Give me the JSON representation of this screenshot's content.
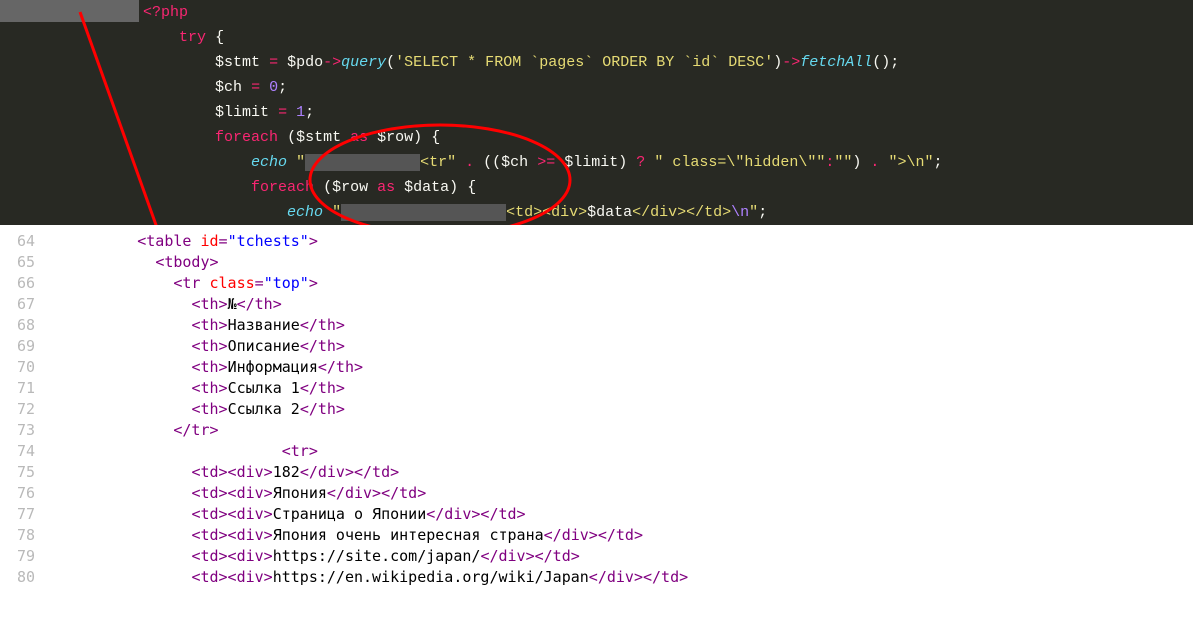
{
  "dark": {
    "php_open": "<?php",
    "try": "try",
    "brace_open": "{",
    "brace_close": "}",
    "stmt": "$stmt",
    "eq": "=",
    "pdo": "$pdo",
    "arrow": "->",
    "query": "query",
    "lparen": "(",
    "rparen": ")",
    "sql1": "'SELECT * FROM `pages` ORDER BY `id` DESC'",
    "fetchAll": "fetchAll",
    "semi": ";",
    "ch": "$ch",
    "zero": "0",
    "limit": "$limit",
    "one": "1",
    "foreach": "foreach",
    "as": "as",
    "row": "$row",
    "data": "$data",
    "echo": "echo",
    "quote": "\"",
    "tr_frag": "<tr\"",
    "dot": ".",
    "ternary1_open": "((",
    "gte": ">=",
    "ternary1_close": ")",
    "q": "?",
    "class_hidden": "\" class=\\\"hidden\\\"\"",
    "colon": ":",
    "empty": "\"\"",
    "close_paren": ")",
    "end_frag": "\">\\n\"",
    "td_frag": "<td><div>",
    "data_close": "</div></td>",
    "nl": "\\n"
  },
  "light": {
    "lines": [
      {
        "n": 64,
        "ind": 8,
        "parts": [
          [
            "tag",
            "<table "
          ],
          [
            "attr",
            "id"
          ],
          [
            "tag",
            "="
          ],
          [
            "attval",
            "\"tchests\""
          ],
          [
            "tag",
            ">"
          ]
        ]
      },
      {
        "n": 65,
        "ind": 10,
        "parts": [
          [
            "tag",
            "<tbody>"
          ]
        ]
      },
      {
        "n": 66,
        "ind": 12,
        "parts": [
          [
            "tag",
            "<tr "
          ],
          [
            "attr",
            "class"
          ],
          [
            "tag",
            "="
          ],
          [
            "attval",
            "\"top\""
          ],
          [
            "tag",
            ">"
          ]
        ]
      },
      {
        "n": 67,
        "ind": 14,
        "parts": [
          [
            "tag",
            "<th>"
          ],
          [
            "text",
            "№"
          ],
          [
            "tag",
            "</th>"
          ]
        ]
      },
      {
        "n": 68,
        "ind": 14,
        "parts": [
          [
            "tag",
            "<th>"
          ],
          [
            "text",
            "Название"
          ],
          [
            "tag",
            "</th>"
          ]
        ]
      },
      {
        "n": 69,
        "ind": 14,
        "parts": [
          [
            "tag",
            "<th>"
          ],
          [
            "text",
            "Описание"
          ],
          [
            "tag",
            "</th>"
          ]
        ]
      },
      {
        "n": 70,
        "ind": 14,
        "parts": [
          [
            "tag",
            "<th>"
          ],
          [
            "text",
            "Информация"
          ],
          [
            "tag",
            "</th>"
          ]
        ]
      },
      {
        "n": 71,
        "ind": 14,
        "parts": [
          [
            "tag",
            "<th>"
          ],
          [
            "text",
            "Ссылка 1"
          ],
          [
            "tag",
            "</th>"
          ]
        ]
      },
      {
        "n": 72,
        "ind": 14,
        "parts": [
          [
            "tag",
            "<th>"
          ],
          [
            "text",
            "Ссылка 2"
          ],
          [
            "tag",
            "</th>"
          ]
        ]
      },
      {
        "n": 73,
        "ind": 12,
        "parts": [
          [
            "tag",
            "</tr>"
          ]
        ]
      },
      {
        "n": 74,
        "ind": 24,
        "parts": [
          [
            "tag",
            "<tr>"
          ]
        ]
      },
      {
        "n": 75,
        "ind": 14,
        "parts": [
          [
            "tag",
            "<td><div>"
          ],
          [
            "text",
            "182"
          ],
          [
            "tag",
            "</div></td>"
          ]
        ]
      },
      {
        "n": 76,
        "ind": 14,
        "parts": [
          [
            "tag",
            "<td><div>"
          ],
          [
            "text",
            "Япония"
          ],
          [
            "tag",
            "</div></td>"
          ]
        ]
      },
      {
        "n": 77,
        "ind": 14,
        "parts": [
          [
            "tag",
            "<td><div>"
          ],
          [
            "text",
            "Страница о Японии"
          ],
          [
            "tag",
            "</div></td>"
          ]
        ]
      },
      {
        "n": 78,
        "ind": 14,
        "parts": [
          [
            "tag",
            "<td><div>"
          ],
          [
            "text",
            "Япония очень интересная страна"
          ],
          [
            "tag",
            "</div></td>"
          ]
        ]
      },
      {
        "n": 79,
        "ind": 14,
        "parts": [
          [
            "tag",
            "<td><div>"
          ],
          [
            "text",
            "https://site.com/japan/"
          ],
          [
            "tag",
            "</div></td>"
          ]
        ]
      },
      {
        "n": 80,
        "ind": 14,
        "parts": [
          [
            "tag",
            "<td><div>"
          ],
          [
            "text",
            "https://en.wikipedia.org/wiki/Japan"
          ],
          [
            "tag",
            "</div></td>"
          ]
        ]
      }
    ]
  }
}
